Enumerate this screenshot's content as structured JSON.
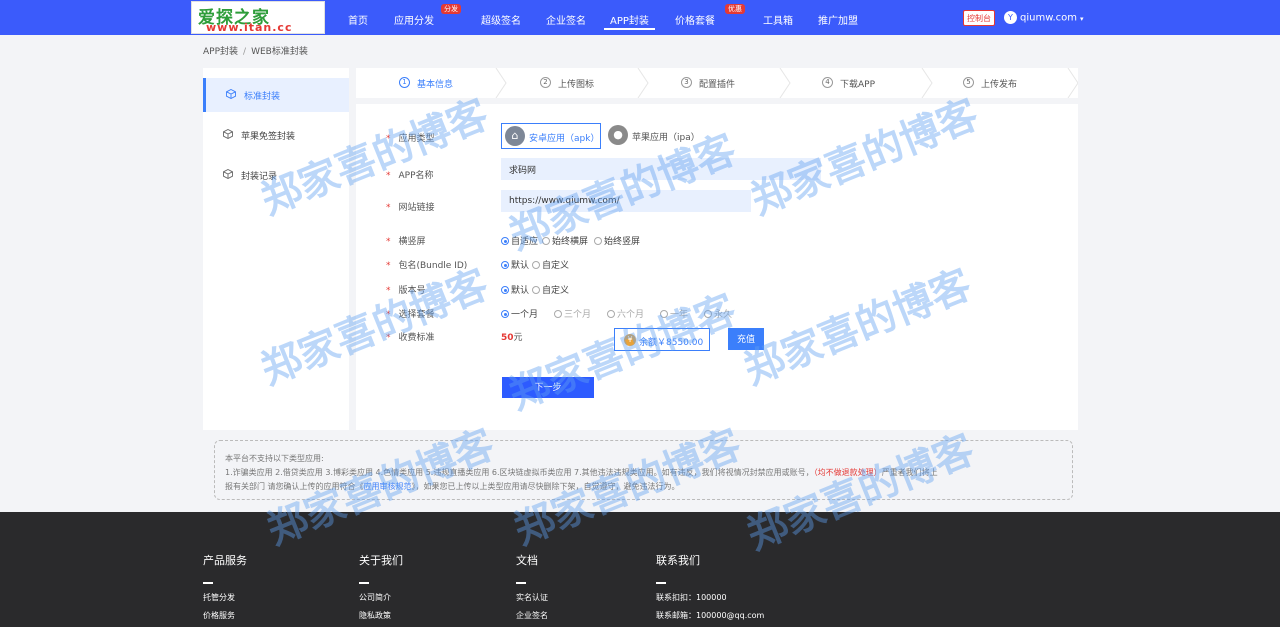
{
  "header": {
    "logo_cn": "爱探之家",
    "logo_url": "www.itan.cc",
    "nav": [
      {
        "label": "首页",
        "badge": ""
      },
      {
        "label": "应用分发",
        "badge": "分发"
      },
      {
        "label": "超级签名",
        "badge": ""
      },
      {
        "label": "企业签名",
        "badge": ""
      },
      {
        "label": "APP封装",
        "badge": ""
      },
      {
        "label": "价格套餐",
        "badge": "优惠"
      },
      {
        "label": "工具箱",
        "badge": ""
      },
      {
        "label": "推广加盟",
        "badge": ""
      }
    ],
    "console": "控制台",
    "avatar_letter": "Y",
    "user": "qiumw.com",
    "caret": "▾"
  },
  "breadcrumb": {
    "root": "APP封装",
    "sep": "/",
    "current": "WEB标准封装"
  },
  "sidebar": {
    "items": [
      {
        "label": "标准封装"
      },
      {
        "label": "苹果免签封装"
      },
      {
        "label": "封装记录"
      }
    ]
  },
  "steps": [
    {
      "num": "1",
      "label": "基本信息"
    },
    {
      "num": "2",
      "label": "上传图标"
    },
    {
      "num": "3",
      "label": "配置插件"
    },
    {
      "num": "4",
      "label": "下载APP"
    },
    {
      "num": "5",
      "label": "上传发布"
    }
  ],
  "form": {
    "req": "*",
    "app_type": {
      "label": "应用类型",
      "android": "安卓应用（apk）",
      "ios": "苹果应用（ipa）"
    },
    "app_name": {
      "label": "APP名称",
      "value": "求码网"
    },
    "site_url": {
      "label": "网站链接",
      "value": "https://www.qiumw.com/"
    },
    "orientation": {
      "label": "横竖屏",
      "options": [
        "自适应",
        "始终横屏",
        "始终竖屏"
      ]
    },
    "bundle": {
      "label": "包名(Bundle ID)",
      "options": [
        "默认",
        "自定义"
      ]
    },
    "version": {
      "label": "版本号",
      "options": [
        "默认",
        "自定义"
      ]
    },
    "package": {
      "label": "选择套餐",
      "options": [
        "一个月",
        "三个月",
        "六个月",
        "一年",
        "永久"
      ]
    },
    "fee": {
      "label": "收费标准",
      "price": "50",
      "unit": "元",
      "balance": "余额￥8550.00",
      "recharge": "充值"
    },
    "next": "下一步"
  },
  "notice": {
    "line1": "本平台不支持以下类型应用:",
    "line2a": "1.诈骗类应用 2.借贷类应用 3.博彩类应用 4.色情类应用 5.违规直播类应用 6.区块链虚拟币类应用 7.其他违法违规类应用。如有违反，我们将视情况封禁应用或账号，",
    "line2b": "（均不做退款处理）",
    "line2c": "严重者我们将上",
    "line3a": "报有关部门 请您确认上传的应用符合《",
    "line3b": "应用审核规范",
    "line3c": "》，如果您已上传以上类型应用请尽快删除下架，自觉遵守，避免违法行为。"
  },
  "footer": {
    "cols": [
      {
        "title": "产品服务",
        "links": [
          "托管分发",
          "价格服务"
        ]
      },
      {
        "title": "关于我们",
        "links": [
          "公司简介",
          "隐私政策"
        ]
      },
      {
        "title": "文档",
        "links": [
          "实名认证",
          "企业签名"
        ]
      },
      {
        "title": "联系我们",
        "links": [
          "联系扣扣：100000",
          "联系邮箱：100000@qq.com"
        ]
      }
    ]
  },
  "watermark": "郑家喜的博客",
  "colors": {
    "primary": "#3b5bfb",
    "accent": "#3b7ffb",
    "danger": "#e53935",
    "footer": "#2a2a2c"
  }
}
